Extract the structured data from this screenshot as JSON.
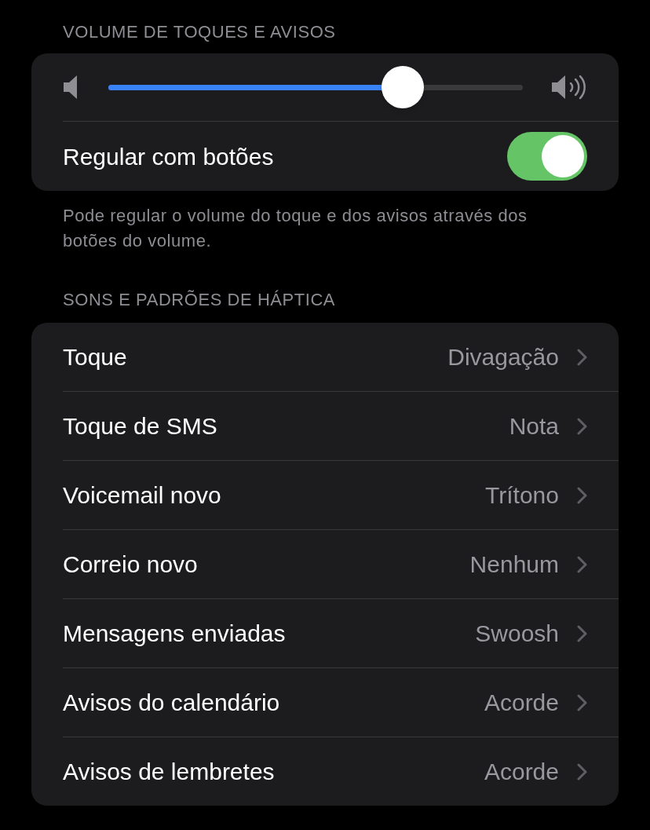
{
  "volume_section": {
    "header": "VOLUME DE TOQUES E AVISOS",
    "slider": {
      "level": 0.71
    },
    "toggle": {
      "label": "Regular com botões",
      "on": true
    },
    "footer": "Pode regular o volume do toque e dos avisos através dos botões do volume."
  },
  "sounds_section": {
    "header": "SONS E PADRÕES DE HÁPTICA",
    "rows": [
      {
        "label": "Toque",
        "value": "Divagação"
      },
      {
        "label": "Toque de SMS",
        "value": "Nota"
      },
      {
        "label": "Voicemail novo",
        "value": "Trítono"
      },
      {
        "label": "Correio novo",
        "value": "Nenhum"
      },
      {
        "label": "Mensagens enviadas",
        "value": "Swoosh"
      },
      {
        "label": "Avisos do calendário",
        "value": "Acorde"
      },
      {
        "label": "Avisos de lembretes",
        "value": "Acorde"
      }
    ]
  }
}
